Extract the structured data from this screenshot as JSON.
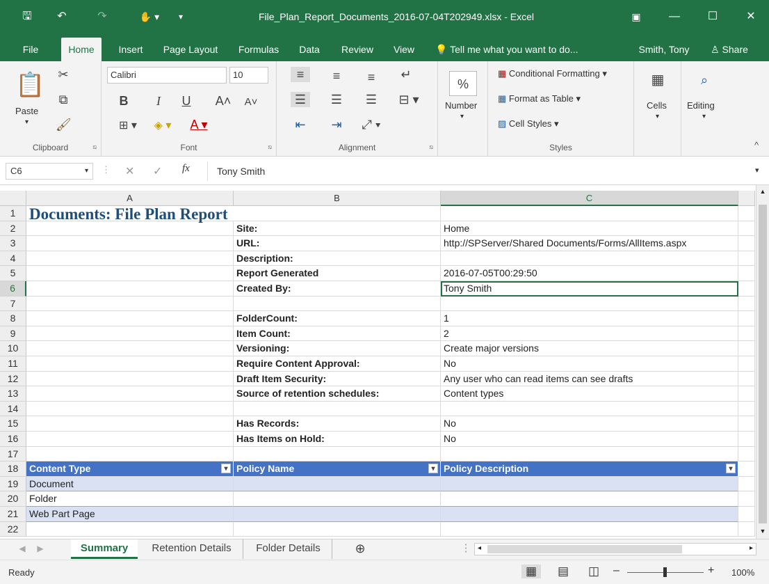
{
  "window": {
    "title": "File_Plan_Report_Documents_2016-07-04T202949.xlsx - Excel",
    "user": "Smith, Tony",
    "share_label": "Share"
  },
  "ribbon_tabs": [
    "File",
    "Home",
    "Insert",
    "Page Layout",
    "Formulas",
    "Data",
    "Review",
    "View"
  ],
  "tell_me": "Tell me what you want to do...",
  "clipboard": {
    "paste_label": "Paste",
    "group_label": "Clipboard"
  },
  "font": {
    "name": "Calibri",
    "size": "10",
    "group_label": "Font",
    "bold": "B",
    "italic": "I",
    "underline": "U"
  },
  "alignment": {
    "group_label": "Alignment"
  },
  "number": {
    "label": "Number",
    "symbol": "%"
  },
  "styles": {
    "conditional": "Conditional Formatting",
    "format_table": "Format as Table",
    "cell_styles": "Cell Styles",
    "group_label": "Styles"
  },
  "cells": {
    "label": "Cells"
  },
  "editing": {
    "label": "Editing"
  },
  "formula_bar": {
    "name_box": "C6",
    "fx": "fx",
    "value": "Tony Smith"
  },
  "columns": [
    "A",
    "B",
    "C"
  ],
  "rows": [
    {
      "n": "1",
      "a": "Documents: File Plan Report",
      "b": "",
      "c": ""
    },
    {
      "n": "2",
      "a": "",
      "b": "Site:",
      "c": "Home"
    },
    {
      "n": "3",
      "a": "",
      "b": "URL:",
      "c": "http://SPServer/Shared Documents/Forms/AllItems.aspx"
    },
    {
      "n": "4",
      "a": "",
      "b": "Description:",
      "c": ""
    },
    {
      "n": "5",
      "a": "",
      "b": "Report Generated",
      "c": "2016-07-05T00:29:50"
    },
    {
      "n": "6",
      "a": "",
      "b": "Created By:",
      "c": "Tony Smith"
    },
    {
      "n": "7",
      "a": "",
      "b": "",
      "c": ""
    },
    {
      "n": "8",
      "a": "",
      "b": "FolderCount:",
      "c": "1"
    },
    {
      "n": "9",
      "a": "",
      "b": "Item Count:",
      "c": "2"
    },
    {
      "n": "10",
      "a": "",
      "b": "Versioning:",
      "c": "Create major versions"
    },
    {
      "n": "11",
      "a": "",
      "b": "Require Content Approval:",
      "c": "No"
    },
    {
      "n": "12",
      "a": "",
      "b": "Draft Item Security:",
      "c": "Any user who can read items can see drafts"
    },
    {
      "n": "13",
      "a": "",
      "b": "Source of retention schedules:",
      "c": "Content types"
    },
    {
      "n": "14",
      "a": "",
      "b": "",
      "c": ""
    },
    {
      "n": "15",
      "a": "",
      "b": "Has Records:",
      "c": "No"
    },
    {
      "n": "16",
      "a": "",
      "b": "Has Items on Hold:",
      "c": "No"
    },
    {
      "n": "17",
      "a": "",
      "b": "",
      "c": ""
    },
    {
      "n": "18",
      "a": "Content Type",
      "b": "Policy Name",
      "c": "Policy Description"
    },
    {
      "n": "19",
      "a": "Document",
      "b": "",
      "c": ""
    },
    {
      "n": "20",
      "a": "Folder",
      "b": "",
      "c": ""
    },
    {
      "n": "21",
      "a": "Web Part Page",
      "b": "",
      "c": ""
    },
    {
      "n": "22",
      "a": "",
      "b": "",
      "c": ""
    }
  ],
  "sheet_tabs": [
    "Summary",
    "Retention Details",
    "Folder Details"
  ],
  "status": {
    "ready": "Ready",
    "zoom": "100%"
  },
  "colors": {
    "excel_green": "#217346",
    "table_header": "#4472c4",
    "banded_row": "#d9e1f2",
    "title_blue": "#1f4e79"
  }
}
